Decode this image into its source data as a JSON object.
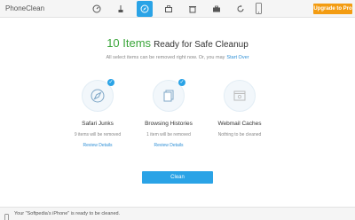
{
  "app": {
    "title": "PhoneClean"
  },
  "toolbar": {
    "icons": [
      "speedometer-icon",
      "broom-icon",
      "compass-icon",
      "toolbox-icon",
      "delete-icon",
      "briefcase-icon",
      "refresh-icon"
    ],
    "active_index": 2,
    "upgrade_label": "Upgrade to Pro"
  },
  "main": {
    "count_text": "10 Items",
    "headline_rest": "Ready for Safe Cleanup",
    "subline": "All select items can be removed right now. Or, you may",
    "subline_link": "Start Over",
    "cards": [
      {
        "title": "Safari Junks",
        "status": "9 items will be removed",
        "link": "Review Details",
        "checked": true,
        "icon": "safari-compass-icon"
      },
      {
        "title": "Browsing Histories",
        "status": "1 item will be removed",
        "link": "Review Details",
        "checked": true,
        "icon": "document-pages-icon"
      },
      {
        "title": "Webmail Caches",
        "status": "Nothing to be cleaned",
        "link": "",
        "checked": false,
        "icon": "browser-window-icon"
      }
    ],
    "clean_label": "Clean"
  },
  "status": {
    "text": "Your \"Softpedia's iPhone\" is ready to be cleaned."
  },
  "colors": {
    "accent": "#2aa3e6",
    "upgrade": "#f39c12",
    "count": "#3aa53a"
  }
}
